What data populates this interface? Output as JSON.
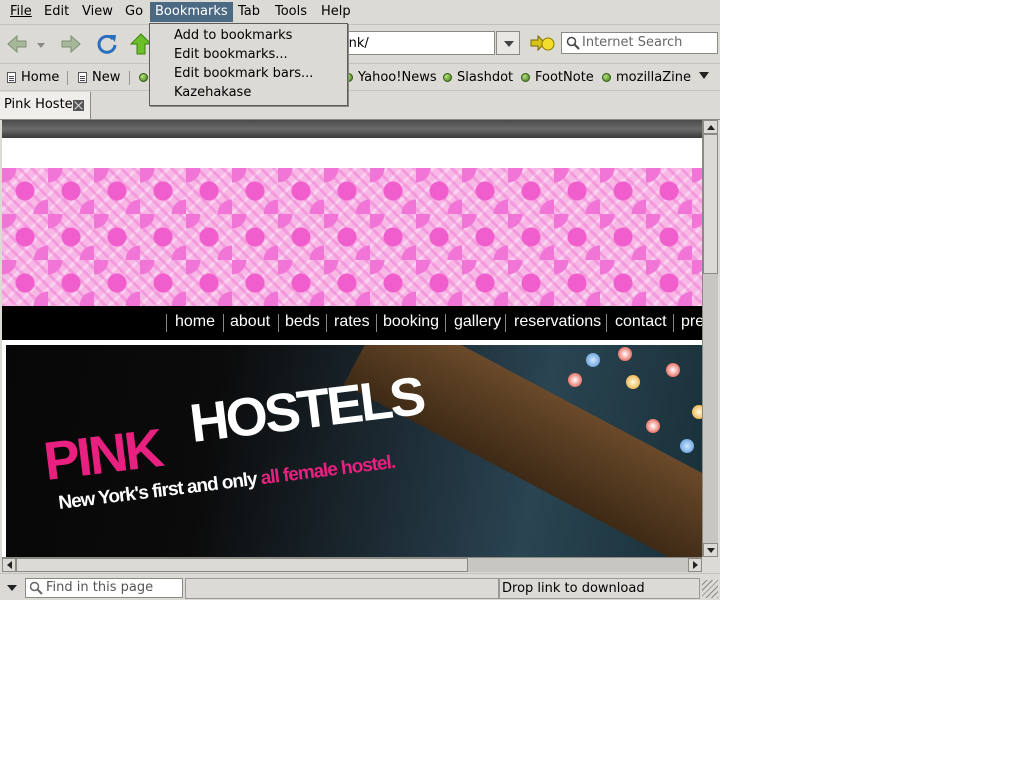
{
  "menubar": {
    "items": [
      {
        "label": "File"
      },
      {
        "label": "Edit"
      },
      {
        "label": "View"
      },
      {
        "label": "Go"
      },
      {
        "label": "Bookmarks"
      },
      {
        "label": "Tab"
      },
      {
        "label": "Tools"
      },
      {
        "label": "Help"
      }
    ],
    "active": "Bookmarks",
    "active_color": "#4b6983"
  },
  "bookmarks_menu": {
    "items": [
      {
        "label": "Add to bookmarks"
      },
      {
        "label": "Edit bookmarks..."
      },
      {
        "label": "Edit bookmark bars..."
      },
      {
        "label": "Kazehakase"
      }
    ]
  },
  "toolbar": {
    "icons": [
      "back-arrow-icon",
      "history-dropdown-icon",
      "forward-arrow-icon",
      "reload-icon",
      "up-arrow-icon",
      "go-icon"
    ],
    "url_visible_fragment": "ink/",
    "search_placeholder": "Internet Search"
  },
  "bookmarks_bar": {
    "items": [
      {
        "label": "Home",
        "icon": "page-icon"
      },
      {
        "label": "New",
        "icon": "page-icon"
      },
      {
        "label": "Yahoo!News",
        "icon": "green-dot-icon"
      },
      {
        "label": "Slashdot",
        "icon": "green-dot-icon"
      },
      {
        "label": "FootNote",
        "icon": "green-dot-icon"
      },
      {
        "label": "mozillaZine",
        "icon": "green-dot-icon"
      }
    ]
  },
  "tabs": [
    {
      "label": "Pink Hostels"
    }
  ],
  "page": {
    "nav": [
      {
        "label": "home"
      },
      {
        "label": "about"
      },
      {
        "label": "beds"
      },
      {
        "label": "rates"
      },
      {
        "label": "booking"
      },
      {
        "label": "gallery"
      },
      {
        "label": "reservations"
      },
      {
        "label": "contact"
      },
      {
        "label": "pre"
      }
    ],
    "hero": {
      "brand_pink": "PINK",
      "brand_white": "HOSTELS",
      "tagline_white": "New York's first and only ",
      "tagline_pink": "all female hostel."
    },
    "brand_color": "#e8207f"
  },
  "statusbar": {
    "find_placeholder": "Find in this page",
    "status": "Drop link to download"
  }
}
